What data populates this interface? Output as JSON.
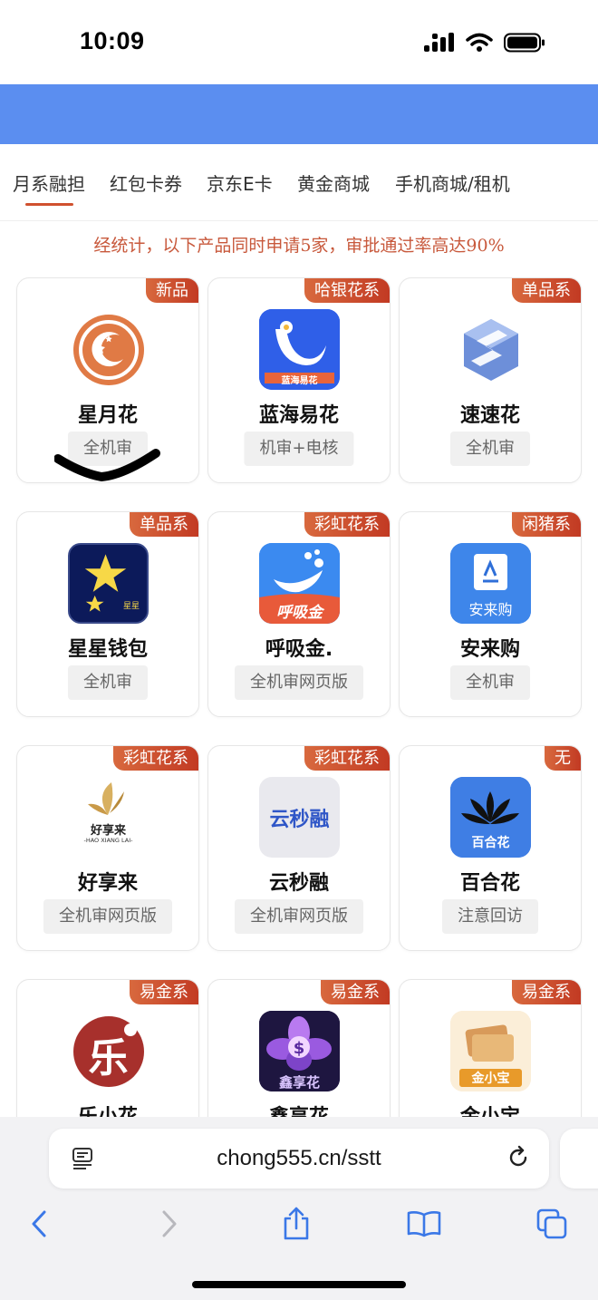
{
  "status_bar": {
    "time": "10:09"
  },
  "tabs": [
    {
      "label": "月系融担",
      "active": true
    },
    {
      "label": "红包卡券",
      "active": false
    },
    {
      "label": "京东E卡",
      "active": false
    },
    {
      "label": "黄金商城",
      "active": false
    },
    {
      "label": "手机商城/租机",
      "active": false
    }
  ],
  "notice": "经统计，以下产品同时申请5家，审批通过率高达90%",
  "products": [
    {
      "tag": "新品",
      "name": "星月花",
      "badge": "全机审",
      "icon": "crescent-moon-icon"
    },
    {
      "tag": "哈银花系",
      "name": "蓝海易花",
      "badge": "机审+电核",
      "icon": "blue-wave-icon",
      "logo_text": "蓝海易花"
    },
    {
      "tag": "单品系",
      "name": "速速花",
      "badge": "全机审",
      "icon": "cube-s-icon"
    },
    {
      "tag": "单品系",
      "name": "星星钱包",
      "badge": "全机审",
      "icon": "stars-icon",
      "logo_text": "星星"
    },
    {
      "tag": "彩虹花系",
      "name": "呼吸金.",
      "badge": "全机审网页版",
      "icon": "whale-icon",
      "logo_text": "呼吸金"
    },
    {
      "tag": "闲猪系",
      "name": "安来购",
      "badge": "全机审",
      "icon": "document-icon",
      "logo_text": "安来购"
    },
    {
      "tag": "彩虹花系",
      "name": "好享来",
      "badge": "全机审网页版",
      "icon": "butterfly-icon",
      "logo_text": "好享来",
      "logo_subtext": "-HAO XIANG LAI-"
    },
    {
      "tag": "彩虹花系",
      "name": "云秒融",
      "badge": "全机审网页版",
      "icon": "cloud-text-icon",
      "logo_text": "云秒融"
    },
    {
      "tag": "无",
      "name": "百合花",
      "badge": "注意回访",
      "icon": "lotus-icon",
      "logo_text": "百合花"
    },
    {
      "tag": "易金系",
      "name": "乐小花",
      "badge": "",
      "icon": "le-character-icon",
      "logo_text": "乐"
    },
    {
      "tag": "易金系",
      "name": "鑫享花",
      "badge": "",
      "icon": "dollar-flower-icon",
      "logo_text": "鑫享花"
    },
    {
      "tag": "易金系",
      "name": "金小宝",
      "badge": "",
      "icon": "wallet-cards-icon",
      "logo_text": "金小宝"
    }
  ],
  "browser": {
    "url": "chong555.cn/sstt"
  },
  "colors": {
    "header_blue": "#5b8ef0",
    "accent_red": "#d0512f",
    "tag_gradient_start": "#d8693e",
    "tag_gradient_end": "#c23a23"
  }
}
